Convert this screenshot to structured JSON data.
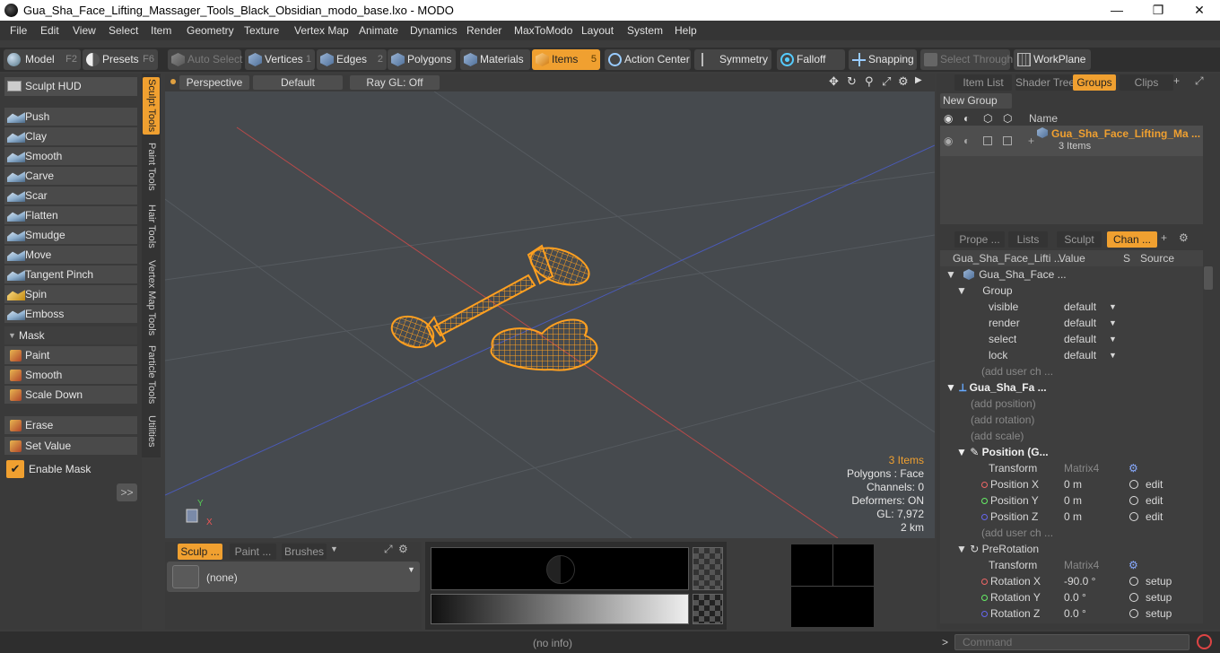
{
  "window": {
    "title": "Gua_Sha_Face_Lifting_Massager_Tools_Black_Obsidian_modo_base.lxo - MODO",
    "minimize": "—",
    "maximize": "❐",
    "close": "✕"
  },
  "menu": [
    "File",
    "Edit",
    "View",
    "Select",
    "Item",
    "Geometry",
    "Texture",
    "Vertex Map",
    "Animate",
    "Dynamics",
    "Render",
    "MaxToModo",
    "Layout",
    "System",
    "Help"
  ],
  "toolbar": {
    "model": "Model",
    "model_key": "F2",
    "presets": "Presets",
    "presets_key": "F6",
    "auto_select": "Auto Select",
    "vertices": "Vertices",
    "vertices_key": "1",
    "edges": "Edges",
    "edges_key": "2",
    "polygons": "Polygons",
    "materials": "Materials",
    "items": "Items",
    "items_key": "5",
    "action_center": "Action Center",
    "symmetry": "Symmetry",
    "falloff": "Falloff",
    "snapping": "Snapping",
    "select_through": "Select Through",
    "workplane": "WorkPlane"
  },
  "left": {
    "sculpt_hud": "Sculpt HUD",
    "tools": [
      "Push",
      "Clay",
      "Smooth",
      "Carve",
      "Scar",
      "Flatten",
      "Smudge",
      "Move",
      "Tangent Pinch",
      "Spin",
      "Emboss"
    ],
    "mask_header": "Mask",
    "mask_tools": [
      "Paint",
      "Smooth",
      "Scale Down"
    ],
    "erase": "Erase",
    "set_value": "Set Value",
    "enable_mask": "Enable Mask",
    "expand": ">>"
  },
  "sidetabs": [
    "Sculpt Tools",
    "Paint Tools",
    "Hair Tools",
    "Vertex Map Tools",
    "Particle Tools",
    "Utilities"
  ],
  "viewport": {
    "view": "Perspective",
    "shading": "Default",
    "raygl": "Ray GL: Off",
    "info": {
      "items": "3 Items",
      "polygons": "Polygons : Face",
      "channels": "Channels: 0",
      "deformers": "Deformers: ON",
      "gl": "GL: 7,972",
      "scale": "2 km"
    },
    "axis_y": "Y",
    "axis_x": "X"
  },
  "right": {
    "tabs": [
      "Item List",
      "Shader Tree",
      "Groups",
      "Clips"
    ],
    "new_group": "New Group",
    "name_col": "Name",
    "group_name": "Gua_Sha_Face_Lifting_Ma ...",
    "group_count": "3 Items",
    "tabs2": [
      "Prope ...",
      "Lists",
      "Sculpt",
      "Chan ..."
    ],
    "ch_headers": {
      "name": "Gua_Sha_Face_Lifti ...",
      "value": "Value",
      "s": "S",
      "source": "Source"
    },
    "channels": [
      {
        "name": "Gua_Sha_Face ...",
        "value": "",
        "source": ""
      },
      {
        "name": "Group",
        "value": "",
        "source": ""
      },
      {
        "name": "visible",
        "value": "default",
        "source": ""
      },
      {
        "name": "render",
        "value": "default",
        "source": ""
      },
      {
        "name": "select",
        "value": "default",
        "source": ""
      },
      {
        "name": "lock",
        "value": "default",
        "source": ""
      },
      {
        "name": "(add user ch ...",
        "value": "",
        "source": ""
      },
      {
        "name": "Gua_Sha_Fa ...",
        "value": "",
        "source": ""
      },
      {
        "name": "(add position)",
        "value": "",
        "source": ""
      },
      {
        "name": "(add rotation)",
        "value": "",
        "source": ""
      },
      {
        "name": "(add scale)",
        "value": "",
        "source": ""
      },
      {
        "name": "Position (G...",
        "value": "",
        "source": ""
      },
      {
        "name": "Transform",
        "value": "Matrix4",
        "source": ""
      },
      {
        "name": "Position X",
        "value": "0 m",
        "source": "edit"
      },
      {
        "name": "Position Y",
        "value": "0 m",
        "source": "edit"
      },
      {
        "name": "Position Z",
        "value": "0 m",
        "source": "edit"
      },
      {
        "name": "(add user ch ...",
        "value": "",
        "source": ""
      },
      {
        "name": "PreRotation",
        "value": "",
        "source": ""
      },
      {
        "name": "Transform",
        "value": "Matrix4",
        "source": ""
      },
      {
        "name": "Rotation X",
        "value": "-90.0 °",
        "source": "setup"
      },
      {
        "name": "Rotation Y",
        "value": "0.0 °",
        "source": "setup"
      },
      {
        "name": "Rotation Z",
        "value": "0.0 °",
        "source": "setup"
      }
    ]
  },
  "bottom": {
    "tabs": [
      "Sculp ...",
      "Paint ...",
      "Brushes"
    ],
    "preset": "(none)"
  },
  "status": {
    "info": "(no info)",
    "command_placeholder": "Command",
    "prompt": ">"
  },
  "colors": {
    "accent": "#f0a030",
    "bg": "#3c3c3c",
    "wire": "#ffa020"
  }
}
